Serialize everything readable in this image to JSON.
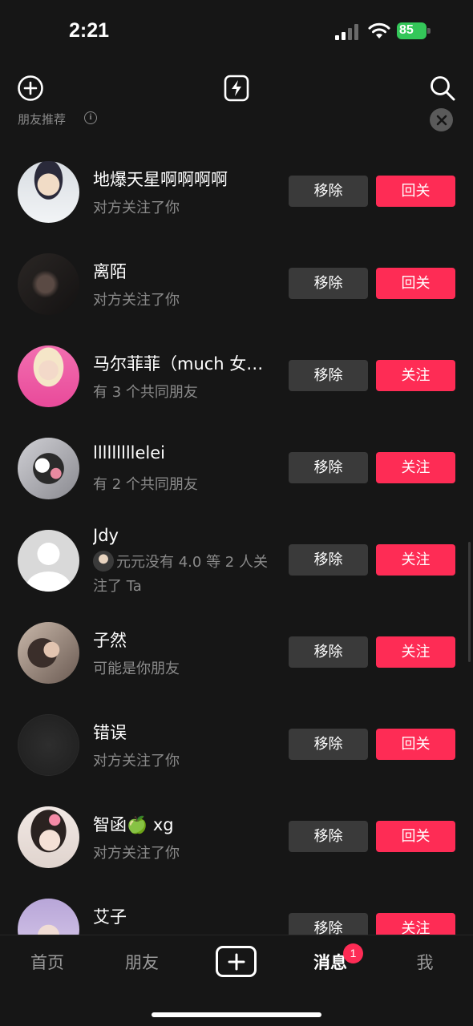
{
  "status": {
    "time": "2:21",
    "battery": "85"
  },
  "top_bar": {
    "left_icon": "add-circle-icon",
    "center_icon": "lightning-icon",
    "right_icon": "search-icon"
  },
  "section": {
    "title": "朋友推荐"
  },
  "buttons": {
    "remove": "移除"
  },
  "rows": [
    {
      "name": "地爆天星啊啊啊啊",
      "sub": "对方关注了你",
      "action": "回关"
    },
    {
      "name": "离陌",
      "sub": "对方关注了你",
      "action": "回关"
    },
    {
      "name": "马尔菲菲（much 女…",
      "sub": "有 3 个共同朋友",
      "action": "关注"
    },
    {
      "name": "lllllllllelei",
      "sub": "有 2 个共同朋友",
      "action": "关注"
    },
    {
      "name": "Jdy",
      "sub": "元元没有 4.0 等 2 人关注了 Ta",
      "action": "关注"
    },
    {
      "name": "子然",
      "sub": "可能是你朋友",
      "action": "关注"
    },
    {
      "name": "错误",
      "sub": "对方关注了你",
      "action": "回关"
    },
    {
      "name": "智函🍏 xg",
      "sub": "对方关注了你",
      "action": "回关"
    },
    {
      "name": "艾子",
      "sub": "",
      "action": "关注"
    }
  ],
  "tabs": [
    {
      "label": "首页"
    },
    {
      "label": "朋友"
    },
    {
      "label": "消息",
      "badge": "1"
    },
    {
      "label": "我"
    }
  ],
  "colors": {
    "accent": "#fe2c55",
    "background": "#161616",
    "secondary_button": "#3a3a3a"
  }
}
